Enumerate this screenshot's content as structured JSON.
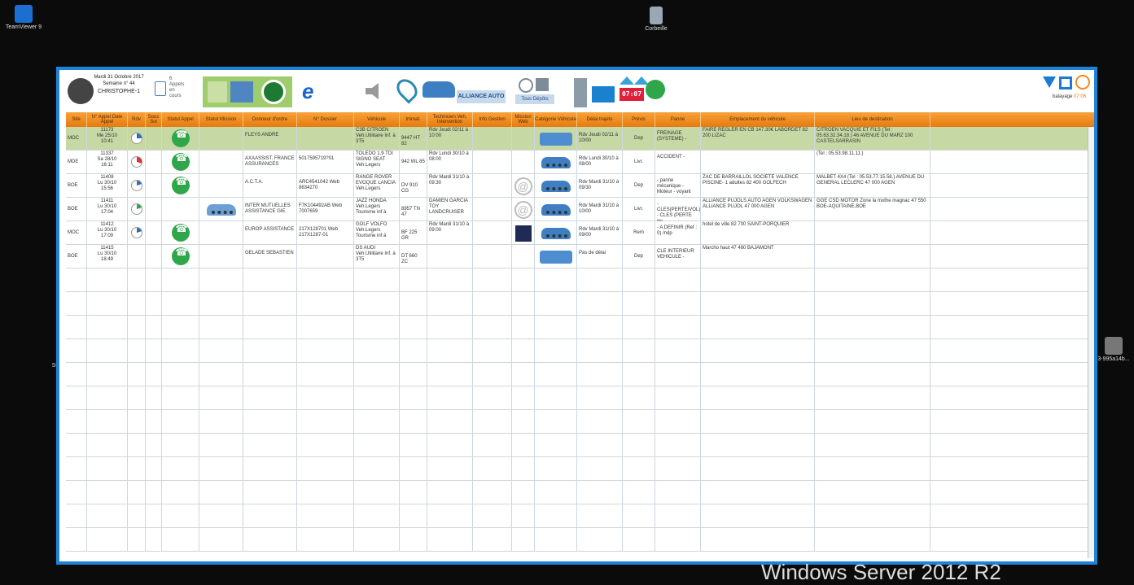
{
  "desktop": {
    "teamviewer_label": "TeamViewer 9",
    "recycle_label": "Corbeille",
    "file_label": "3-995a14b...",
    "os_label": "Windows Server 2012 R2",
    "left_edge_label": "St"
  },
  "toolbar": {
    "date": "Mardi 31 Octobre 2017",
    "week": "Semaine n° 44",
    "user": "CHRISTOPHE-1",
    "calls_count": "6",
    "calls_label1": "Appels",
    "calls_label2": "en",
    "calls_label3": "cours",
    "alliance_label": "ALLIANCE AUTO",
    "depots_label": "Tous Dépôts",
    "clock": "07:07",
    "balayage_label": "balayage",
    "balayage_time": "07:06"
  },
  "columns": [
    "Site",
    "N° Appel Date Appel",
    "Rdv",
    "Sous Sol",
    "Statut Appel",
    "Statut Mission",
    "Donneur d'ordre",
    "N° Dossier",
    "Véhicule",
    "Immat.",
    "Technicien Veh. Intervention",
    "Info Gestion",
    "Mission Web",
    "Catégorie Véhicule",
    "Délai trajets",
    "Prévis",
    "Panne",
    "Emplacement du véhicule",
    "Lieu de destination"
  ],
  "rows": [
    {
      "site": "MOC",
      "appel": "11173",
      "date": "Me 25/10",
      "time": "10:41",
      "donneur": "FLEYS ANDRE",
      "dossier": "",
      "vehicule": "C3B CITROEN Veh.Utilitaire Inf. à 3T5",
      "immat": "9447 HT 82",
      "tech": "Rdv Jeudi 02/11 à 10:00",
      "info": "",
      "delai": "Rdv Jeudi 02/11 à 10/00",
      "previs": "Dep",
      "panne": "FREINAGE (SYSTEME) -",
      "emplacement": "FAIRE REGLER EN CB 147.30€ LABORDET 82 200 LIZAC",
      "destination": "CITROEN VACQUIE ET FILS (Tel : 05.63.32.34.18.) 46 AVENUE DU MARZ 100 CASTELSARRASIN"
    },
    {
      "site": "MDE",
      "appel": "11337",
      "date": "Sa 28/10",
      "time": "16:11",
      "donneur": "AXAASSIST. FRANCE ASSURANCES",
      "dossier": "5017595719?01",
      "vehicule": "TOLEDO 1.9 TDI SIGNO SEAT Veh.Legers",
      "immat": "942 WL 85",
      "tech": "Rdv Lundi 30/10 à 08:00",
      "info": "",
      "delai": "Rdv Lundi 30/10 à 08/00",
      "previs": "Livr.",
      "panne": "ACCIDENT -",
      "emplacement": "",
      "destination": "(Tel : 05.53.98.11.11.)"
    },
    {
      "site": "BOE",
      "appel": "11408",
      "date": "Lu 30/10",
      "time": "15:56",
      "donneur": "A.C.T.A.",
      "dossier": "ARC4541042 Web 8634270",
      "vehicule": "RANGE ROVER EVOQUE LANCIA Veh.Legers",
      "immat": "DV 910 CG",
      "tech": "Rdv Mardi 31/10 à 09:30",
      "info": "",
      "delai": "Rdv Mardi 31/10 à 09/30",
      "previs": "Dep",
      "panne": "- panne mécanique - Moteur - voyant",
      "emplacement": "ZAC DE BARRAILLOL SOCIÉTÉ VALENCE PISCINE- 1 adultes 82 400 GOLFECH",
      "destination": "MALBET 4X4 (Tel : 05.53.77.15.58.) AVENUE DU GENERAL LECLERC 47 000 AGEN"
    },
    {
      "site": "BOE",
      "appel": "11411",
      "date": "Lu 30/10",
      "time": "17:04",
      "donneur": "INTER MUTUELLES ASSISTANCE GIE",
      "dossier": "F7K104492AB Web 7007659",
      "vehicule": "JAZZ HONDA Veh.Legers Tourisme inf à",
      "immat": "8957 TN 47",
      "tech": "DAMIEN GARCIA TOY LANDCRUISER",
      "info": "",
      "delai": "Rdv Mardi 31/10 à 10/00",
      "previs": "Livr.",
      "panne": "- CLES(PERTE/VOL) - CLES (PERTE ou",
      "emplacement": "ALLIANCE PUJOLS AUTO AGEN VOLKSWAGEN ALLIANCE PUJOL 47 000 AGEN",
      "destination": "GGE CSD MOTOR Zone la mothe magnac 47 550 BOE-AQUITAINE,BOE"
    },
    {
      "site": "MOC",
      "appel": "11412",
      "date": "Lu 30/10",
      "time": "17:09",
      "donneur": "EUROP ASSISTANCE",
      "dossier": "217X128701 Web 217X1287-01",
      "vehicule": "GOLF VOLFO Veh.Legers Tourisme inf à",
      "immat": "BF 225 GR",
      "tech": "Rdv Mardi 31/10 à 09:00",
      "info": "",
      "delai": "Rdv Mardi 31/10 à 09/00",
      "previs": "Rem",
      "panne": "- A DEFINIR (Ref : 0) /ndp",
      "emplacement": "hotel de ville 82 700 SAINT-PORQUIER",
      "destination": ""
    },
    {
      "site": "BOE",
      "appel": "11415",
      "date": "Lu 30/10",
      "time": "18:49",
      "donneur": "GELADE SEBASTIEN",
      "dossier": "",
      "vehicule": "DS AUDI Veh.Utilitaire Inf. à 3T5",
      "immat": "DT 660 ZC",
      "tech": "",
      "info": "",
      "delai": "Pas de délai",
      "previs": "Dep",
      "panne": "CLE INTERIEUR VEHICULE -",
      "emplacement": "Marcho haut 47 480 BAJAMONT",
      "destination": ""
    }
  ]
}
